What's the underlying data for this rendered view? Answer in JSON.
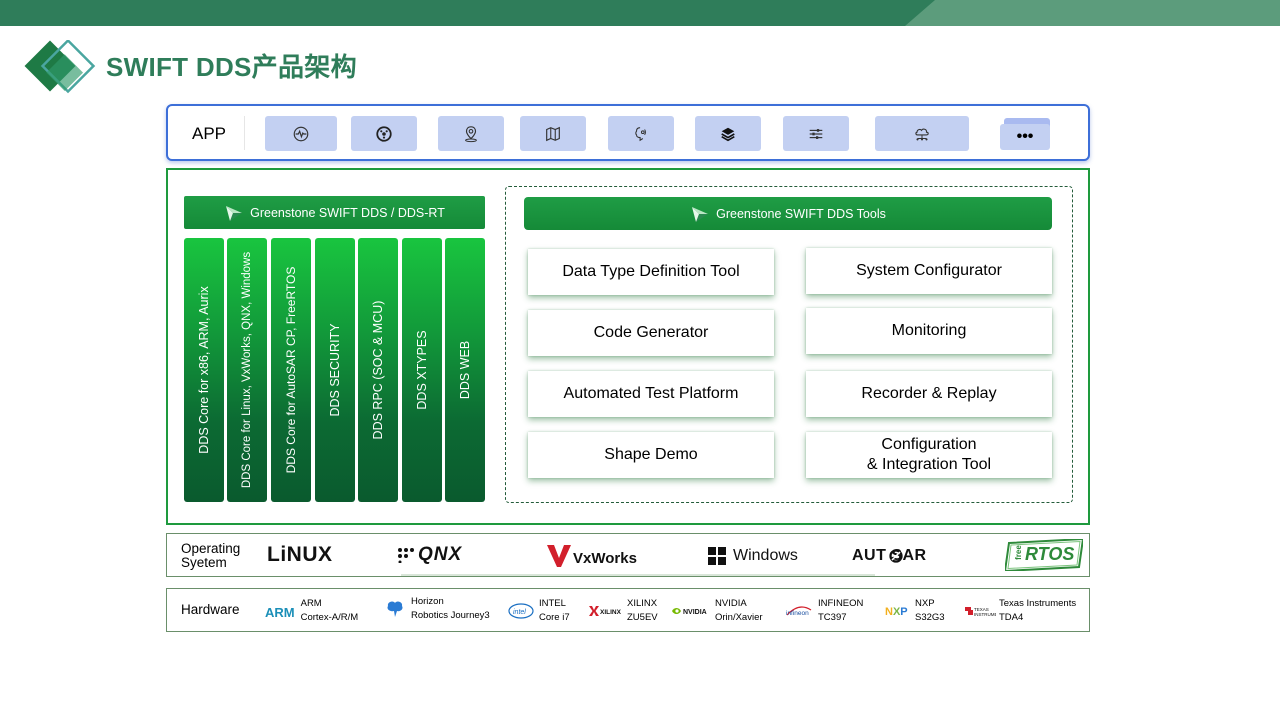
{
  "title": "SWIFT DDS产品架构",
  "colors": {
    "primary_green": "#1e9a3e",
    "dark_green": "#2f7d5a",
    "app_blue": "#3d6fd8",
    "icon_bg": "#c3d0f2"
  },
  "app": {
    "label": "APP",
    "icons": [
      "activity-icon",
      "steering-wheel-icon",
      "location-pin-icon",
      "map-icon",
      "voice-assistant-icon",
      "layers-icon",
      "sliders-icon",
      "cloud-network-icon"
    ],
    "more": "•••"
  },
  "core": {
    "header": "Greenstone  SWIFT DDS / DDS-RT",
    "columns": [
      "DDS Core for x86, ARM, Aurix",
      "DDS Core for Linux, VxWorks, QNX, Windows",
      "DDS Core for AutoSAR CP, FreeRTOS",
      "DDS SECURITY",
      "DDS RPC (SOC & MCU)",
      "DDS XTYPES",
      "DDS WEB"
    ]
  },
  "tools": {
    "header": "Greenstone  SWIFT DDS Tools",
    "left": [
      "Data Type Definition Tool",
      "Code Generator",
      "Automated Test Platform",
      "Shape Demo"
    ],
    "right": [
      "System Configurator",
      "Monitoring",
      "Recorder & Replay",
      "Configuration\n& Integration Tool"
    ]
  },
  "os": {
    "label_line1": "Operating",
    "label_line2": "Syetem",
    "logos": {
      "linux": "LiNUX",
      "qnx": "QNX",
      "vxworks": "VxWorks",
      "windows": "Windows",
      "autosar": "AUT SAR",
      "freertos": "RTOS",
      "freertos_small": "free"
    }
  },
  "hardware": {
    "label": "Hardware",
    "items": [
      {
        "logo": "ARM",
        "line1": "ARM",
        "line2": "Cortex-A/R/M"
      },
      {
        "logo": "horizon",
        "line1": "Horizon",
        "line2": "Robotics Journey3"
      },
      {
        "logo": "intel",
        "line1": "INTEL",
        "line2": "Core i7"
      },
      {
        "logo": "XILINX",
        "line1": "XILINX",
        "line2": "ZU5EV"
      },
      {
        "logo": "NVIDIA",
        "line1": "NVIDIA",
        "line2": "Orin/Xavier"
      },
      {
        "logo": "infineon",
        "line1": "INFINEON",
        "line2": "TC397"
      },
      {
        "logo": "NXP",
        "line1": "NXP",
        "line2": "S32G3"
      },
      {
        "logo": "TEXAS INSTRUMENTS",
        "line1": "Texas Instruments",
        "line2": "TDA4"
      }
    ]
  }
}
